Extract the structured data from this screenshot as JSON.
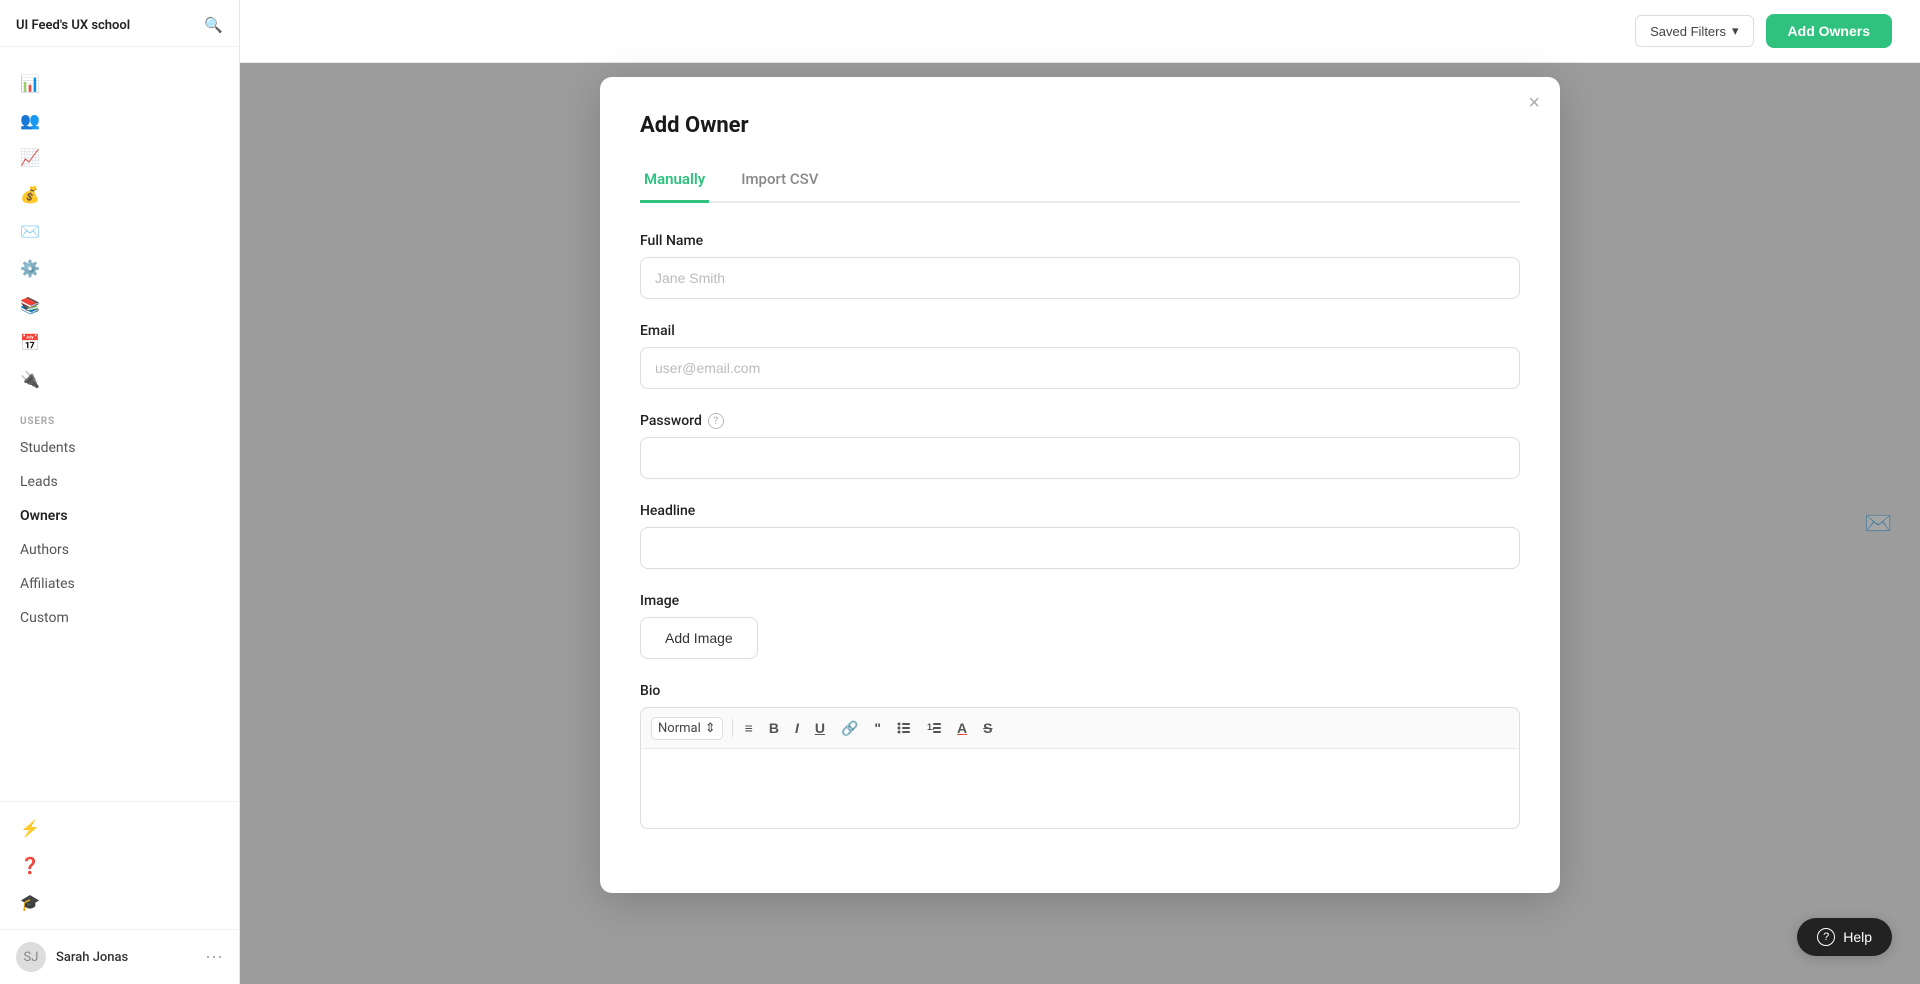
{
  "app": {
    "title": "UI Feed's UX school"
  },
  "sidebar": {
    "section_users": "USERS",
    "items": [
      {
        "id": "students",
        "label": "Students",
        "icon": "👤"
      },
      {
        "id": "leads",
        "label": "Leads",
        "icon": "📋"
      },
      {
        "id": "owners",
        "label": "Owners",
        "icon": "🏠",
        "active": true
      },
      {
        "id": "authors",
        "label": "Authors",
        "icon": "✍️"
      },
      {
        "id": "affiliates",
        "label": "Affiliates",
        "icon": "🔗"
      },
      {
        "id": "custom",
        "label": "Custom",
        "icon": "⚙️"
      }
    ],
    "nav_icons": [
      {
        "id": "dashboard",
        "icon": "📊"
      },
      {
        "id": "users-nav",
        "icon": "👥"
      },
      {
        "id": "analytics",
        "icon": "📈"
      },
      {
        "id": "revenue",
        "icon": "💰"
      },
      {
        "id": "messages",
        "icon": "✉️"
      },
      {
        "id": "settings",
        "icon": "⚙️"
      },
      {
        "id": "library",
        "icon": "📚"
      },
      {
        "id": "calendar",
        "icon": "📅"
      },
      {
        "id": "integrations",
        "icon": "🔌"
      }
    ],
    "bottom_icons": [
      {
        "id": "flash",
        "icon": "⚡"
      },
      {
        "id": "help",
        "icon": "❓"
      },
      {
        "id": "grad",
        "icon": "🎓"
      }
    ],
    "user_name": "Sarah Jonas",
    "user_more": "⋯"
  },
  "header": {
    "saved_filters_label": "Saved Filters",
    "add_owners_label": "Add Owners"
  },
  "modal": {
    "title": "Add Owner",
    "close_label": "×",
    "tabs": [
      {
        "id": "manually",
        "label": "Manually",
        "active": true
      },
      {
        "id": "import-csv",
        "label": "Import CSV",
        "active": false
      }
    ],
    "fields": {
      "full_name": {
        "label": "Full Name",
        "placeholder": "Jane Smith"
      },
      "email": {
        "label": "Email",
        "placeholder": "user@email.com"
      },
      "password": {
        "label": "Password",
        "placeholder": ""
      },
      "headline": {
        "label": "Headline",
        "placeholder": ""
      },
      "image": {
        "label": "Image",
        "add_button": "Add Image"
      },
      "bio": {
        "label": "Bio"
      }
    },
    "bio_toolbar": {
      "normal_label": "Normal",
      "chevron": "⇕",
      "align": "≡",
      "bold": "B",
      "italic": "I",
      "underline": "U",
      "link": "🔗",
      "quote": "❝",
      "ul": "≡",
      "ol": "1.",
      "text_color": "A",
      "strikethrough": "S"
    }
  },
  "help_btn": {
    "label": "Help"
  }
}
